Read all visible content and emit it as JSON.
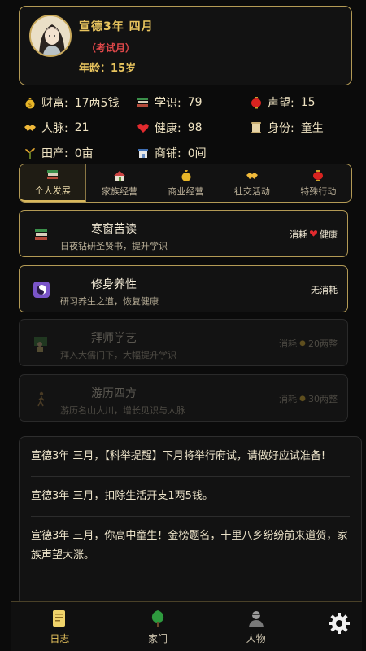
{
  "header": {
    "title": "宣德3年 四月",
    "subtitle": "（考试月）",
    "age": "年龄：15岁"
  },
  "stats": [
    {
      "label": "财富:",
      "value": "17两5钱",
      "icon": "money-bag-icon"
    },
    {
      "label": "学识:",
      "value": "79",
      "icon": "books-icon"
    },
    {
      "label": "声望:",
      "value": "15",
      "icon": "red-lantern-icon"
    },
    {
      "label": "人脉:",
      "value": "21",
      "icon": "handshake-icon"
    },
    {
      "label": "健康:",
      "value": "98",
      "icon": "heart-icon"
    },
    {
      "label": "身份:",
      "value": "童生",
      "icon": "scroll-icon"
    },
    {
      "label": "田产:",
      "value": "0亩",
      "icon": "sprout-icon"
    },
    {
      "label": "商铺:",
      "value": "0间",
      "icon": "shop-icon"
    }
  ],
  "tabs": [
    {
      "label": "个人发展",
      "icon": "books-icon",
      "active": true
    },
    {
      "label": "家族经营",
      "icon": "house-icon",
      "active": false
    },
    {
      "label": "商业经营",
      "icon": "money-bag-icon",
      "active": false
    },
    {
      "label": "社交活动",
      "icon": "handshake-icon",
      "active": false
    },
    {
      "label": "特殊行动",
      "icon": "red-lantern-icon",
      "active": false
    }
  ],
  "actions": [
    {
      "title": "寒窗苦读",
      "desc": "日夜钻研圣贤书，提升学识",
      "cost_prefix": "消耗",
      "cost": "健康",
      "cost_icon": "heart-icon",
      "enabled": true
    },
    {
      "title": "修身养性",
      "desc": "研习养生之道，恢复健康",
      "cost_prefix": "",
      "cost": "无消耗",
      "cost_icon": "",
      "enabled": true
    },
    {
      "title": "拜师学艺",
      "desc": "拜入大儒门下，大幅提升学识",
      "cost_prefix": "消耗",
      "cost": "20两整",
      "cost_icon": "money-bag-icon",
      "enabled": false
    },
    {
      "title": "游历四方",
      "desc": "游历名山大川，增长见识与人脉",
      "cost_prefix": "消耗",
      "cost": "30两整",
      "cost_icon": "money-bag-icon",
      "enabled": false
    }
  ],
  "log": [
    "宣德3年 三月，【科举提醒】下月将举行府试，请做好应试准备!",
    "宣德3年 三月，扣除生活开支1两5钱。",
    "宣德3年 三月，你高中童生！金榜题名，十里八乡纷纷前来道贺，家族声望大涨。"
  ],
  "bottom_nav": [
    {
      "label": "日志",
      "icon": "notebook-icon",
      "active": true
    },
    {
      "label": "家门",
      "icon": "tree-icon",
      "active": false
    },
    {
      "label": "人物",
      "icon": "person-icon",
      "active": false
    }
  ],
  "settings_icon": "gear-icon",
  "colors": {
    "accent": "#e8c45e",
    "alert": "#e0484a",
    "border": "#b39a55"
  }
}
